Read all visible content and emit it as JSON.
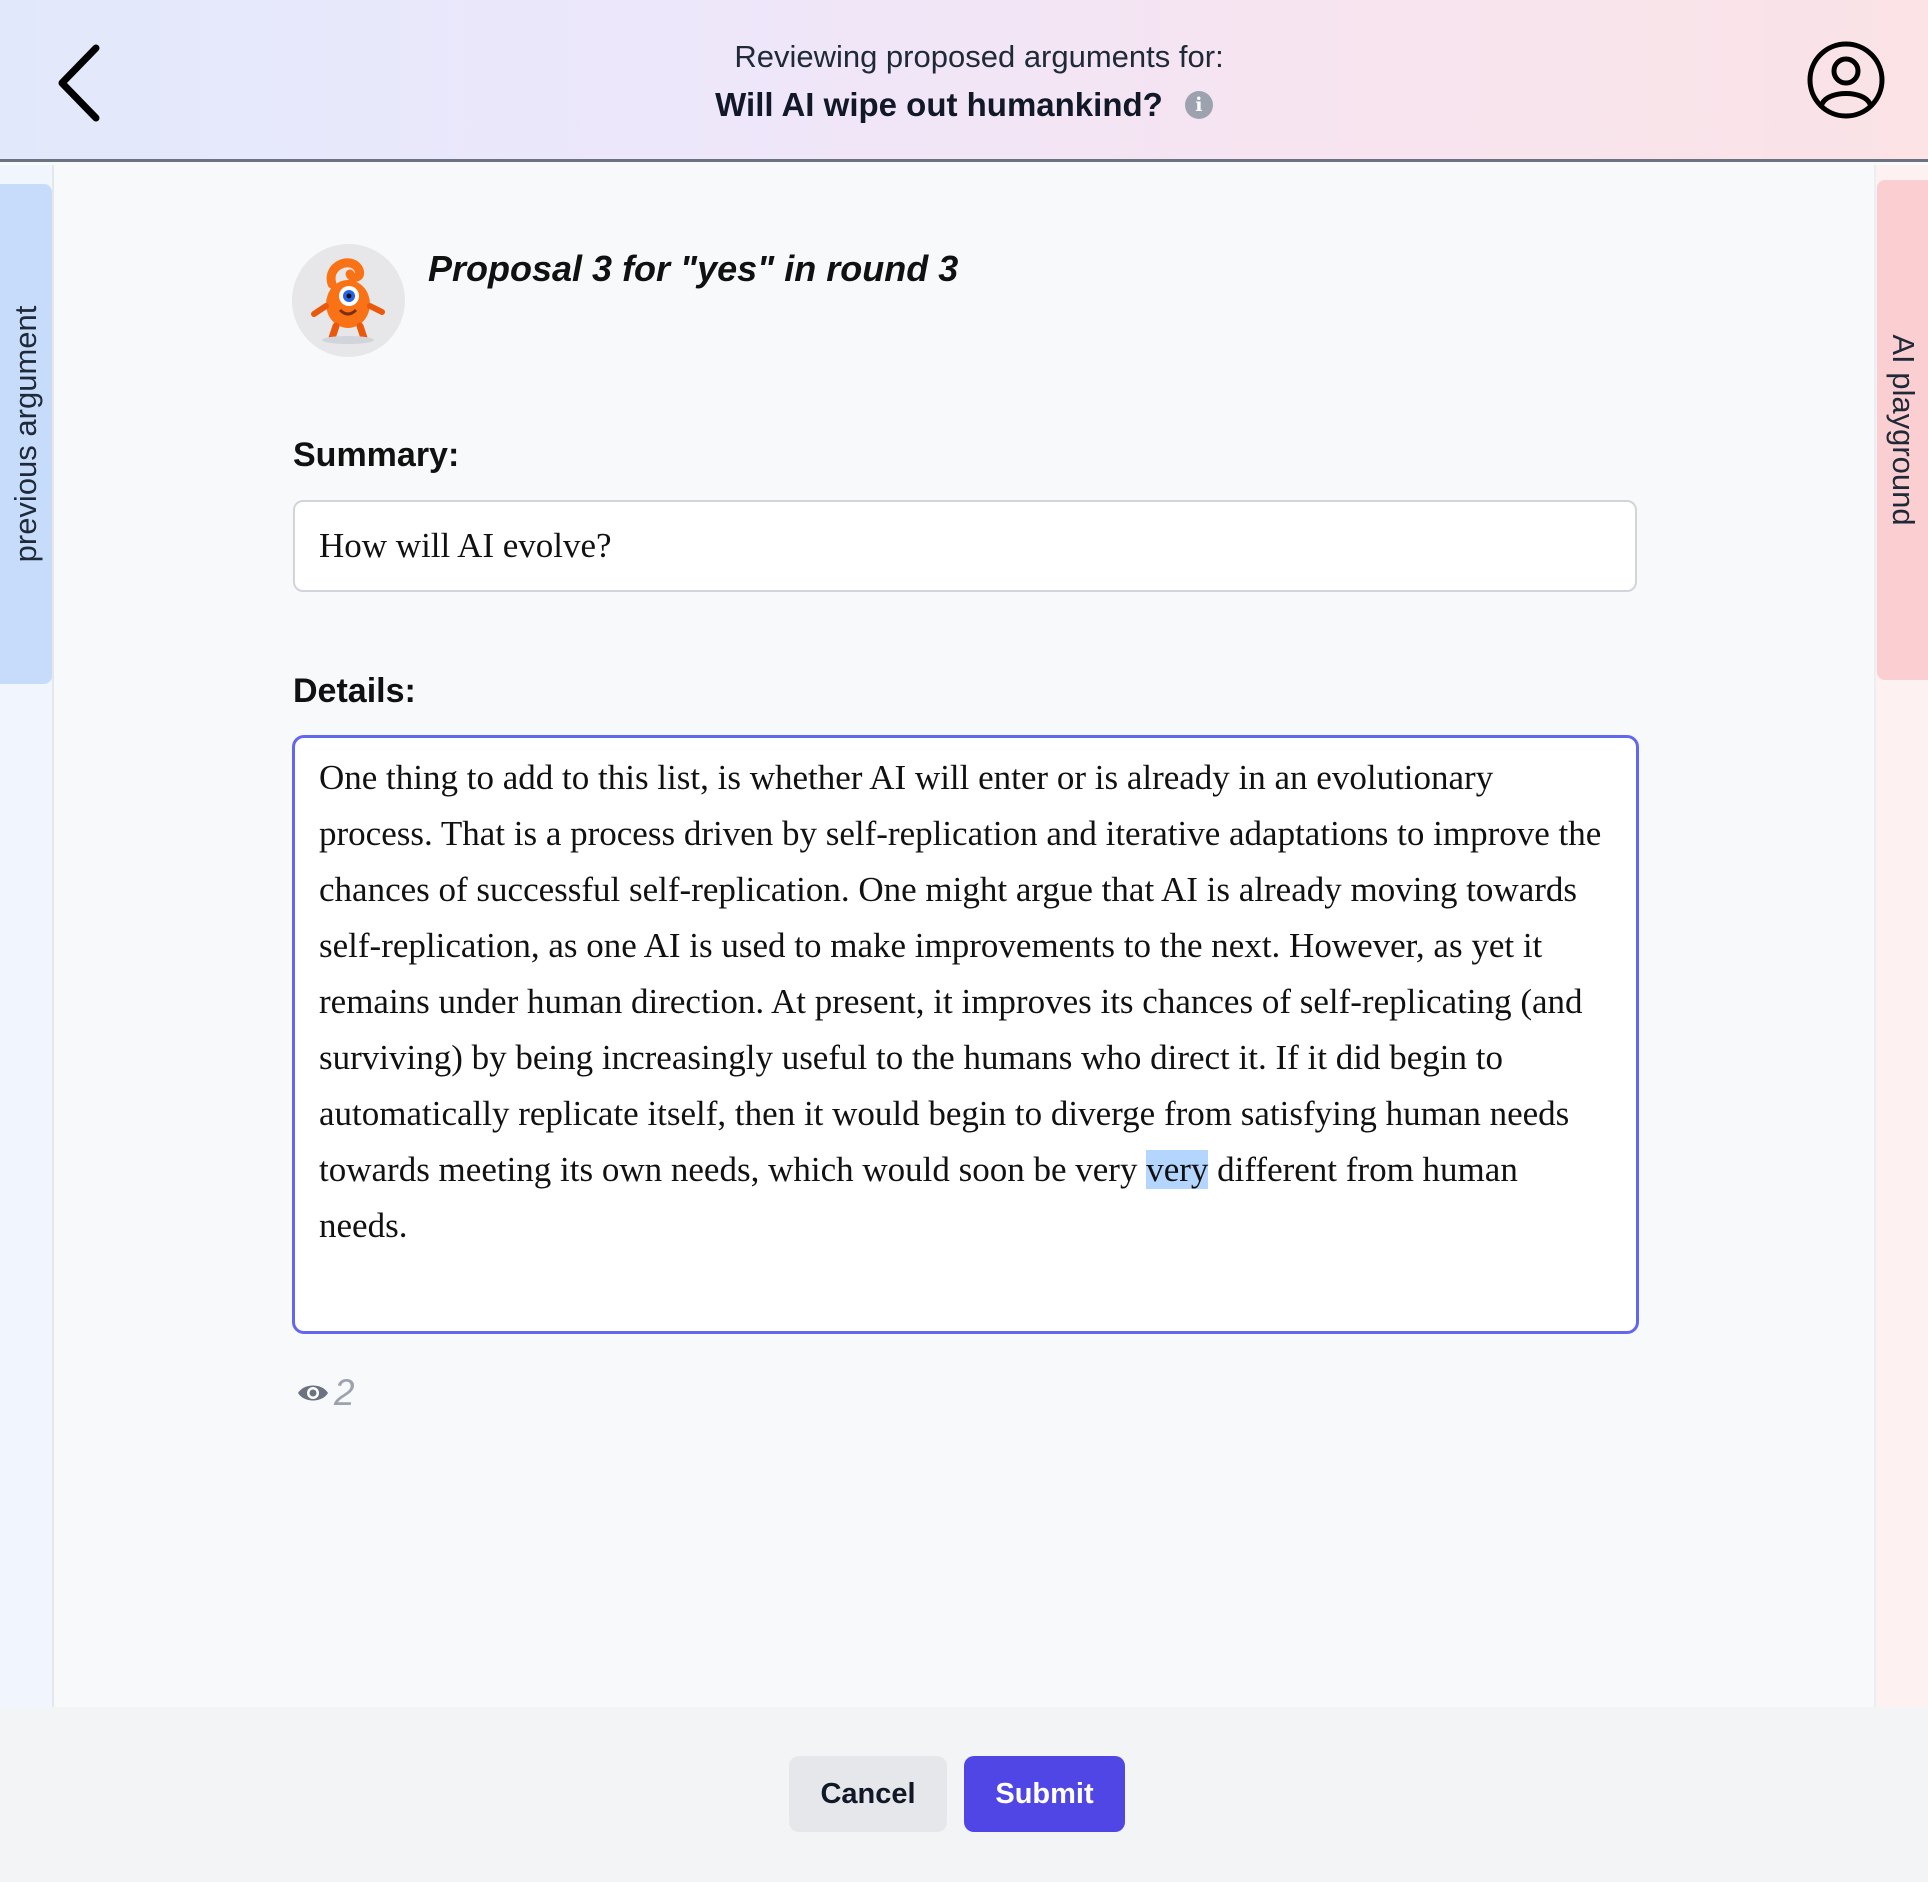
{
  "header": {
    "subtitle": "Reviewing proposed arguments for:",
    "title": "Will AI wipe out humankind?",
    "info_icon": "info-icon",
    "back_icon": "chevron-left-icon",
    "account_icon": "user-circle-icon"
  },
  "side_tabs": {
    "left_label": "previous argument",
    "right_label": "AI playground"
  },
  "proposal": {
    "title": "Proposal 3 for \"yes\" in round 3",
    "avatar_icon": "orange-monster-avatar"
  },
  "form": {
    "summary_label": "Summary:",
    "summary_value": "How will AI evolve?",
    "details_label": "Details:",
    "details_before_selection": "One thing to add to this list, is whether AI will enter or is already in an evolutionary process. That is a process driven by self-replication and iterative adaptations to improve the chances of successful self-replication. One might argue that AI is already moving towards self-replication, as one AI is used to make improvements to the next. However, as yet it remains under human direction. At present, it improves its chances of self-replicating (and surviving) by being increasingly useful to the humans who direct it. If it did begin to automatically replicate itself, then it would begin to diverge from satisfying human needs towards meeting its own needs, which would soon be very ",
    "details_selected": "very",
    "details_after_selection": " different from human needs.",
    "views_count": "2",
    "views_icon": "eye-icon"
  },
  "footer": {
    "cancel_label": "Cancel",
    "submit_label": "Submit"
  },
  "colors": {
    "accent": "#4f46e5",
    "focus_border": "#6366f1",
    "left_tab": "#c7dcfb",
    "right_tab": "#fbcfd1",
    "selection": "#b4d5fe"
  }
}
